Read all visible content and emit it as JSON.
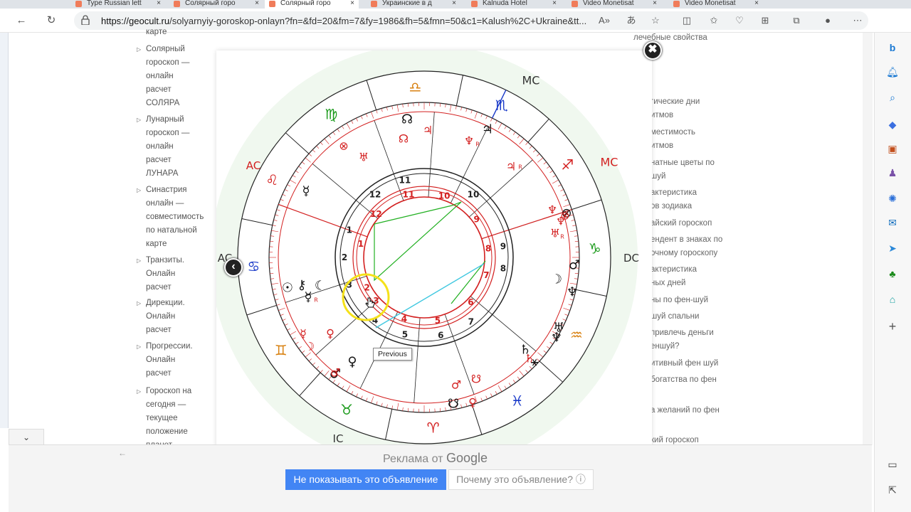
{
  "browser": {
    "tabs": [
      {
        "label": "Type Russian lett"
      },
      {
        "label": "Солярный горо"
      },
      {
        "label": "Солярный горо",
        "active": true
      },
      {
        "label": "Украинские в д"
      },
      {
        "label": "Kalnuda Hotel"
      },
      {
        "label": "Video Monetisat"
      },
      {
        "label": "Video Monetisat"
      }
    ],
    "url_host": "https://geocult.ru",
    "url_path": "/solyarnyiy-goroskop-onlayn?fn=&fd=20&fm=7&fy=1986&fh=5&fmn=50&c1=Kalush%2C+Ukraine&tt...",
    "close_char": "×"
  },
  "left_nav": {
    "top_fragment": "карте",
    "items": [
      {
        "label": "Солярный гороскоп — онлайн расчет СОЛЯРА",
        "lines": [
          "Солярный",
          "гороскоп —",
          "онлайн",
          "расчет",
          "СОЛЯРА"
        ]
      },
      {
        "label": "Лунарный гороскоп — онлайн расчет ЛУНАРА",
        "lines": [
          "Лунарный",
          "гороскоп —",
          "онлайн",
          "расчет",
          "ЛУНАРА"
        ]
      },
      {
        "label": "Синастрия онлайн — совместимость по натальной карте",
        "lines": [
          "Синастрия",
          "онлайн —",
          "совместимость",
          "по натальной",
          "карте"
        ]
      },
      {
        "label": "Транзиты. Онлайн расчет",
        "lines": [
          "Транзиты.",
          "Онлайн",
          "расчет"
        ]
      },
      {
        "label": "Дирекции. Онлайн расчет",
        "lines": [
          "Дирекции.",
          "Онлайн",
          "расчет"
        ]
      },
      {
        "label": "Прогрессии. Онлайн расчет",
        "lines": [
          "Прогрессии.",
          "Онлайн",
          "расчет"
        ]
      },
      {
        "label": "Гороскоп на сегодня — текущее положение планет",
        "lines": [
          "Гороскоп на",
          "сегодня —",
          "текущее",
          "положение",
          "планет"
        ]
      }
    ]
  },
  "right_col": {
    "links": [
      "лечебные свойства",
      "гические дни",
      "итмов",
      "местимость",
      "итмов",
      "натные цветы по",
      "шуй",
      "актеристика",
      "ов зодиака",
      "айский гороскоп",
      "ендент в знаках по",
      "очному гороскопу",
      "актеристика",
      "ных дней",
      "ны по фен-шуй",
      "шуй спальни",
      "привлечь деньги",
      "еншуй?",
      "итивный фен шуй",
      "богатства по фен",
      "а желаний по фен",
      "кий гороскоп"
    ]
  },
  "modal": {
    "close_char": "✖",
    "prev_char": "‹",
    "tooltip": "Previous"
  },
  "chart": {
    "labels": {
      "mc_outer": "MC",
      "mc_inner": "MC",
      "ac_outer": "AC",
      "ac_inner": "AC",
      "dc": "DC",
      "ic": "IC"
    },
    "outer_houses": [
      "1",
      "2",
      "3",
      "4",
      "5",
      "6",
      "7",
      "8",
      "9",
      "10",
      "11",
      "12"
    ],
    "inner_houses": [
      "1",
      "2",
      "3",
      "4",
      "5",
      "6",
      "7",
      "8",
      "9",
      "10",
      "11",
      "12"
    ],
    "signs": [
      {
        "name": "aries-sign",
        "glyph": "♈",
        "color": "#d32020"
      },
      {
        "name": "taurus-sign",
        "glyph": "♉",
        "color": "#1a9a1a"
      },
      {
        "name": "gemini-sign",
        "glyph": "♊",
        "color": "#d88010"
      },
      {
        "name": "cancer-sign",
        "glyph": "♋",
        "color": "#1838c8"
      },
      {
        "name": "leo-sign",
        "glyph": "♌",
        "color": "#d32020"
      },
      {
        "name": "virgo-sign",
        "glyph": "♍",
        "color": "#1a9a1a"
      },
      {
        "name": "libra-sign",
        "glyph": "♎",
        "color": "#d88010"
      },
      {
        "name": "scorpio-sign",
        "glyph": "♏",
        "color": "#1838c8"
      },
      {
        "name": "sagittarius-sign",
        "glyph": "♐",
        "color": "#d32020"
      },
      {
        "name": "capricorn-sign",
        "glyph": "♑",
        "color": "#1a9a1a"
      },
      {
        "name": "aquarius-sign",
        "glyph": "♒",
        "color": "#d88010"
      },
      {
        "name": "pisces-sign",
        "glyph": "♓",
        "color": "#1838c8"
      }
    ],
    "planets_black": [
      "☊",
      "☿",
      "⚷",
      "☾",
      "☉",
      "☿",
      "♂",
      "☽",
      "♆",
      "♅",
      "♄",
      "⚹",
      "♀",
      "☋",
      "⊗",
      "♃",
      "♆",
      "♂"
    ],
    "planets_red": [
      "☊",
      "♃",
      "⊗",
      "♅",
      "♆",
      "♃",
      "♅",
      "♆",
      "⊗",
      "☿",
      "♄",
      "♀",
      "♂",
      "☽",
      "♂",
      "☋",
      "♀",
      "♆"
    ],
    "retro": "R"
  },
  "ad": {
    "label_prefix": "Реклама от",
    "label_brand": "Google",
    "hide_button": "Не показывать это объявление",
    "why_button": "Почему это объявление? ⓘ"
  },
  "colors": {
    "red": "#d32020",
    "green": "#1a9a1a",
    "blue": "#1838c8",
    "orange": "#d88010",
    "cyan": "#40c8e0",
    "accent": "#4285f4"
  }
}
